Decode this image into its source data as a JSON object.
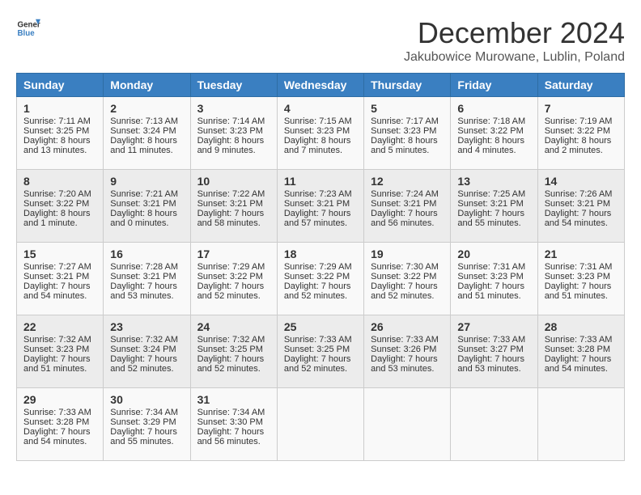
{
  "header": {
    "logo_general": "General",
    "logo_blue": "Blue",
    "month_title": "December 2024",
    "location": "Jakubowice Murowane, Lublin, Poland"
  },
  "days_of_week": [
    "Sunday",
    "Monday",
    "Tuesday",
    "Wednesday",
    "Thursday",
    "Friday",
    "Saturday"
  ],
  "weeks": [
    [
      {
        "day": "1",
        "lines": [
          "Sunrise: 7:11 AM",
          "Sunset: 3:25 PM",
          "Daylight: 8 hours",
          "and 13 minutes."
        ]
      },
      {
        "day": "2",
        "lines": [
          "Sunrise: 7:13 AM",
          "Sunset: 3:24 PM",
          "Daylight: 8 hours",
          "and 11 minutes."
        ]
      },
      {
        "day": "3",
        "lines": [
          "Sunrise: 7:14 AM",
          "Sunset: 3:23 PM",
          "Daylight: 8 hours",
          "and 9 minutes."
        ]
      },
      {
        "day": "4",
        "lines": [
          "Sunrise: 7:15 AM",
          "Sunset: 3:23 PM",
          "Daylight: 8 hours",
          "and 7 minutes."
        ]
      },
      {
        "day": "5",
        "lines": [
          "Sunrise: 7:17 AM",
          "Sunset: 3:23 PM",
          "Daylight: 8 hours",
          "and 5 minutes."
        ]
      },
      {
        "day": "6",
        "lines": [
          "Sunrise: 7:18 AM",
          "Sunset: 3:22 PM",
          "Daylight: 8 hours",
          "and 4 minutes."
        ]
      },
      {
        "day": "7",
        "lines": [
          "Sunrise: 7:19 AM",
          "Sunset: 3:22 PM",
          "Daylight: 8 hours",
          "and 2 minutes."
        ]
      }
    ],
    [
      {
        "day": "8",
        "lines": [
          "Sunrise: 7:20 AM",
          "Sunset: 3:22 PM",
          "Daylight: 8 hours",
          "and 1 minute."
        ]
      },
      {
        "day": "9",
        "lines": [
          "Sunrise: 7:21 AM",
          "Sunset: 3:21 PM",
          "Daylight: 8 hours",
          "and 0 minutes."
        ]
      },
      {
        "day": "10",
        "lines": [
          "Sunrise: 7:22 AM",
          "Sunset: 3:21 PM",
          "Daylight: 7 hours",
          "and 58 minutes."
        ]
      },
      {
        "day": "11",
        "lines": [
          "Sunrise: 7:23 AM",
          "Sunset: 3:21 PM",
          "Daylight: 7 hours",
          "and 57 minutes."
        ]
      },
      {
        "day": "12",
        "lines": [
          "Sunrise: 7:24 AM",
          "Sunset: 3:21 PM",
          "Daylight: 7 hours",
          "and 56 minutes."
        ]
      },
      {
        "day": "13",
        "lines": [
          "Sunrise: 7:25 AM",
          "Sunset: 3:21 PM",
          "Daylight: 7 hours",
          "and 55 minutes."
        ]
      },
      {
        "day": "14",
        "lines": [
          "Sunrise: 7:26 AM",
          "Sunset: 3:21 PM",
          "Daylight: 7 hours",
          "and 54 minutes."
        ]
      }
    ],
    [
      {
        "day": "15",
        "lines": [
          "Sunrise: 7:27 AM",
          "Sunset: 3:21 PM",
          "Daylight: 7 hours",
          "and 54 minutes."
        ]
      },
      {
        "day": "16",
        "lines": [
          "Sunrise: 7:28 AM",
          "Sunset: 3:21 PM",
          "Daylight: 7 hours",
          "and 53 minutes."
        ]
      },
      {
        "day": "17",
        "lines": [
          "Sunrise: 7:29 AM",
          "Sunset: 3:22 PM",
          "Daylight: 7 hours",
          "and 52 minutes."
        ]
      },
      {
        "day": "18",
        "lines": [
          "Sunrise: 7:29 AM",
          "Sunset: 3:22 PM",
          "Daylight: 7 hours",
          "and 52 minutes."
        ]
      },
      {
        "day": "19",
        "lines": [
          "Sunrise: 7:30 AM",
          "Sunset: 3:22 PM",
          "Daylight: 7 hours",
          "and 52 minutes."
        ]
      },
      {
        "day": "20",
        "lines": [
          "Sunrise: 7:31 AM",
          "Sunset: 3:23 PM",
          "Daylight: 7 hours",
          "and 51 minutes."
        ]
      },
      {
        "day": "21",
        "lines": [
          "Sunrise: 7:31 AM",
          "Sunset: 3:23 PM",
          "Daylight: 7 hours",
          "and 51 minutes."
        ]
      }
    ],
    [
      {
        "day": "22",
        "lines": [
          "Sunrise: 7:32 AM",
          "Sunset: 3:23 PM",
          "Daylight: 7 hours",
          "and 51 minutes."
        ]
      },
      {
        "day": "23",
        "lines": [
          "Sunrise: 7:32 AM",
          "Sunset: 3:24 PM",
          "Daylight: 7 hours",
          "and 52 minutes."
        ]
      },
      {
        "day": "24",
        "lines": [
          "Sunrise: 7:32 AM",
          "Sunset: 3:25 PM",
          "Daylight: 7 hours",
          "and 52 minutes."
        ]
      },
      {
        "day": "25",
        "lines": [
          "Sunrise: 7:33 AM",
          "Sunset: 3:25 PM",
          "Daylight: 7 hours",
          "and 52 minutes."
        ]
      },
      {
        "day": "26",
        "lines": [
          "Sunrise: 7:33 AM",
          "Sunset: 3:26 PM",
          "Daylight: 7 hours",
          "and 53 minutes."
        ]
      },
      {
        "day": "27",
        "lines": [
          "Sunrise: 7:33 AM",
          "Sunset: 3:27 PM",
          "Daylight: 7 hours",
          "and 53 minutes."
        ]
      },
      {
        "day": "28",
        "lines": [
          "Sunrise: 7:33 AM",
          "Sunset: 3:28 PM",
          "Daylight: 7 hours",
          "and 54 minutes."
        ]
      }
    ],
    [
      {
        "day": "29",
        "lines": [
          "Sunrise: 7:33 AM",
          "Sunset: 3:28 PM",
          "Daylight: 7 hours",
          "and 54 minutes."
        ]
      },
      {
        "day": "30",
        "lines": [
          "Sunrise: 7:34 AM",
          "Sunset: 3:29 PM",
          "Daylight: 7 hours",
          "and 55 minutes."
        ]
      },
      {
        "day": "31",
        "lines": [
          "Sunrise: 7:34 AM",
          "Sunset: 3:30 PM",
          "Daylight: 7 hours",
          "and 56 minutes."
        ]
      },
      null,
      null,
      null,
      null
    ]
  ]
}
